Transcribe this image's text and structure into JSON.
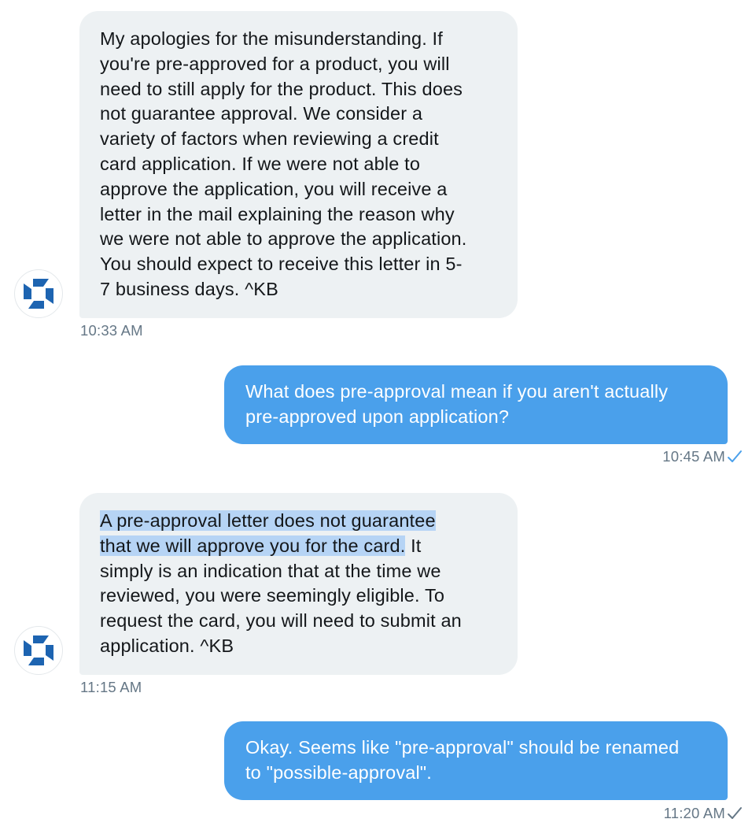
{
  "conversation": {
    "messages": [
      {
        "sender": "Chase",
        "direction": "incoming",
        "lines": [
          "My apologies for the misunderstanding. If",
          "you're pre-approved for a product, you will",
          "need to still apply for the product. This does",
          "not guarantee approval. We consider a",
          "variety of factors when reviewing a credit",
          "card application. If we were not able to",
          "approve the application, you will receive a",
          "letter in the mail explaining the reason why",
          "we were not able to approve the application.",
          "You should expect to receive this letter in 5-",
          "7 business days. ^KB"
        ],
        "time": "10:33 AM",
        "avatar_icon": "chase-octagon-logo-icon"
      },
      {
        "sender": "user",
        "direction": "outgoing",
        "lines": [
          "What does pre-approval mean if you aren't actually",
          "pre-approved upon application?"
        ],
        "time": "10:45 AM",
        "status": "read",
        "status_icon": "checkmark-icon",
        "status_color": "#4aa0eb"
      },
      {
        "sender": "Chase",
        "direction": "incoming",
        "highlighted_text": [
          "A pre-approval letter does not guarantee",
          "that we will approve you for the card."
        ],
        "lines": [
          "A pre-approval letter does not guarantee",
          "that we will approve you for the card. It",
          "simply is an indication that at the time we",
          "reviewed, you were seemingly eligible. To",
          "request the card, you will need to submit an",
          "application. ^KB"
        ],
        "time": "11:15 AM",
        "avatar_icon": "chase-octagon-logo-icon"
      },
      {
        "sender": "user",
        "direction": "outgoing",
        "lines": [
          "Okay. Seems like \"pre-approval\" should be renamed",
          "to \"possible-approval\"."
        ],
        "time": "11:20 AM",
        "status": "sent",
        "status_icon": "checkmark-icon",
        "status_color": "#657786"
      }
    ]
  },
  "colors": {
    "incoming_bubble": "#edf1f3",
    "outgoing_bubble": "#4aa0eb",
    "highlight": "#b6d4f5",
    "timestamp": "#657786",
    "brand_blue": "#1d64b1"
  },
  "fragments": {
    "m3_line2_end": " It"
  }
}
